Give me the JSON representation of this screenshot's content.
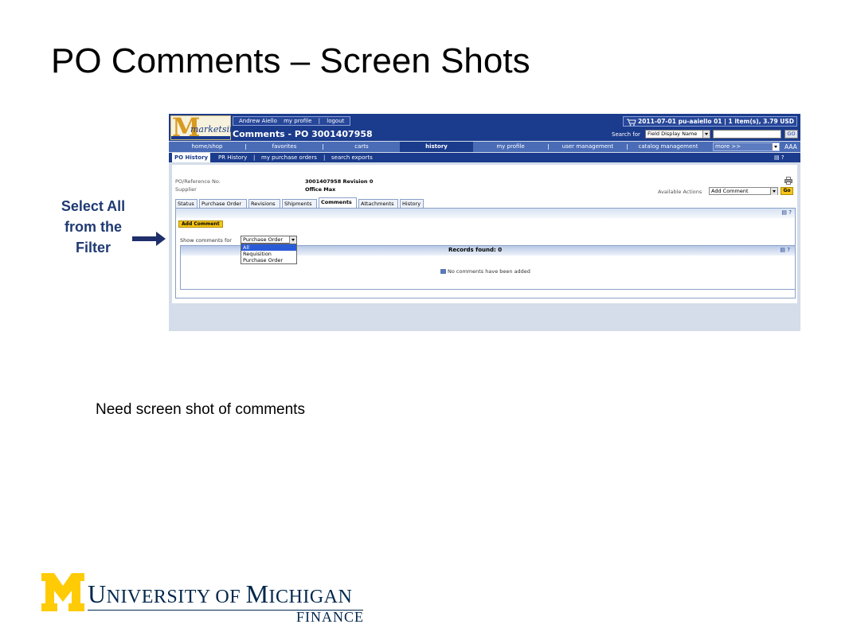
{
  "slide": {
    "title": "PO Comments – Screen Shots",
    "callout": [
      "Select All",
      "from the",
      "Filter"
    ],
    "note": "Need screen shot of comments"
  },
  "colors": {
    "brand_blue": "#1b3b8c",
    "nav_blue": "#4a6cb7",
    "accent_yellow": "#f5c518",
    "um_blue": "#00274c",
    "um_maize": "#ffcb05"
  },
  "app": {
    "logo_letter": "M",
    "logo_text": "marketsite",
    "user_links": [
      "Andrew Aiello",
      "my profile",
      "|",
      "logout"
    ],
    "page_heading": "Comments - PO 3001407958",
    "cart_summary": "2011-07-01 pu-aaiello 01 | 1 item(s), 3.79 USD",
    "cart_icon": "cart-icon",
    "search_label": "Search for",
    "search_field_option": "Field Display Name",
    "search_go": "GO",
    "main_nav": [
      {
        "label": "home/shop"
      },
      {
        "label": "favorites"
      },
      {
        "label": "carts"
      },
      {
        "label": "history",
        "active": true
      },
      {
        "label": "my profile"
      },
      {
        "label": "user management"
      },
      {
        "label": "catalog management"
      }
    ],
    "nav_more": "more >>",
    "font_size_control": "AAA",
    "sub_nav": [
      {
        "label": "PO History",
        "active": true
      },
      {
        "label": "PR History"
      },
      {
        "label": "|"
      },
      {
        "label": "my purchase orders"
      },
      {
        "label": "|"
      },
      {
        "label": "search exports"
      }
    ],
    "po_ref_label": "PO/Reference No.",
    "po_ref_value": "3001407958 Revision 0",
    "supplier_label": "Supplier",
    "supplier_value": "Office Max",
    "available_actions_label": "Available Actions",
    "available_actions_value": "Add Comment",
    "actions_go": "Go",
    "tabs": [
      {
        "label": "Status"
      },
      {
        "label": "Purchase Order"
      },
      {
        "label": "Revisions"
      },
      {
        "label": "Shipments"
      },
      {
        "label": "Comments",
        "active": true
      },
      {
        "label": "Attachments"
      },
      {
        "label": "History"
      }
    ],
    "add_comment_button": "Add Comment",
    "show_comments_label": "Show comments for",
    "show_comments_value": "Purchase Order",
    "show_comments_options": [
      "All",
      "Requisition",
      "Purchase Order"
    ],
    "records_found": "Records found: 0",
    "no_comments": "No comments have been added",
    "help_icon_text": "?"
  },
  "logo": {
    "u": "U",
    "niversity": "NIVERSITY OF ",
    "m": "M",
    "ichigan": "ICHIGAN",
    "finance": "FINANCE"
  }
}
